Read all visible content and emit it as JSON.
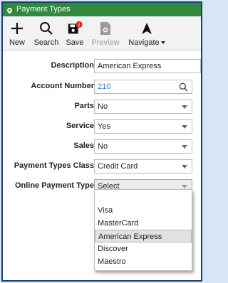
{
  "window": {
    "title": "Payment Types"
  },
  "toolbar": {
    "new_label": "New",
    "search_label": "Search",
    "save_label": "Save",
    "save_badge": "!",
    "preview_label": "Preview",
    "navigate_label": "Navigate"
  },
  "form": {
    "description": {
      "label": "Description",
      "value": "American Express"
    },
    "account_number": {
      "label": "Account Number",
      "value": "210"
    },
    "parts": {
      "label": "Parts",
      "value": "No"
    },
    "service": {
      "label": "Service",
      "value": "Yes"
    },
    "sales": {
      "label": "Sales",
      "value": "No"
    },
    "payment_types_class": {
      "label": "Payment Types Class",
      "value": "Credit Card"
    },
    "online_payment_type": {
      "label": "Online Payment Type",
      "value": "Select"
    }
  },
  "online_payment_options": [
    "",
    "Visa",
    "MasterCard",
    "American Express",
    "Discover",
    "Maestro"
  ],
  "selected_option": "American Express",
  "colors": {
    "titlebar": "#2f8a3d",
    "frame": "#1b3e72",
    "badge": "#d9261c",
    "link": "#2a7bc8"
  }
}
